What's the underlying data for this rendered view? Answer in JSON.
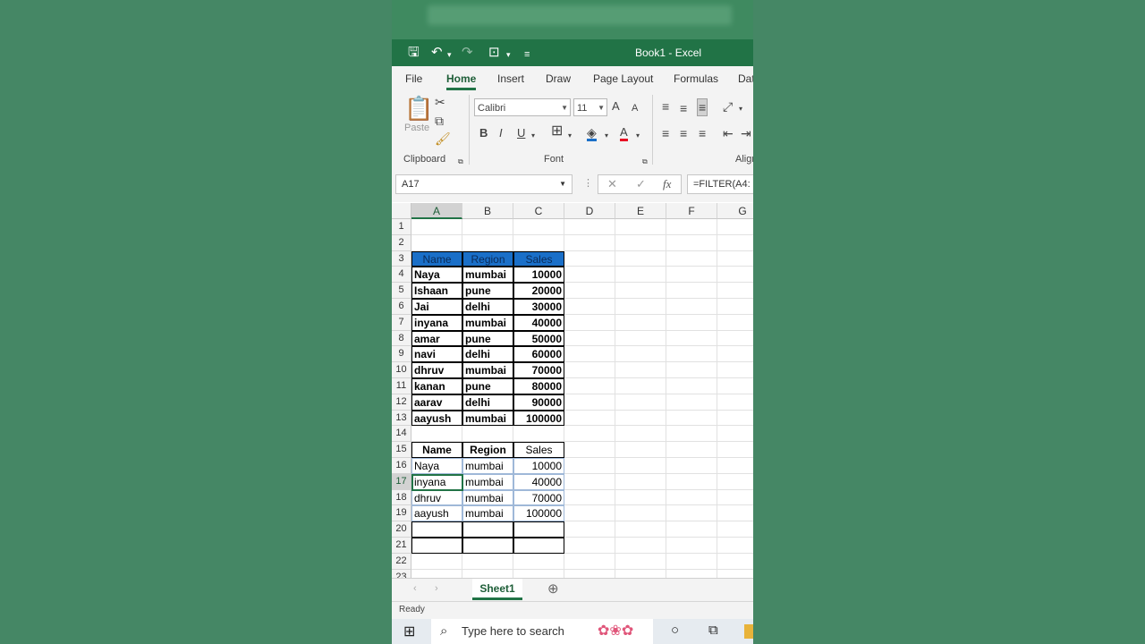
{
  "app": {
    "window_title": "Book1 - Excel"
  },
  "quick_access": {
    "save_icon": "save-icon",
    "undo_icon": "undo-icon",
    "redo_icon": "redo-icon",
    "customize_icon": "customize-icon"
  },
  "ribbon_tabs": [
    "File",
    "Home",
    "Insert",
    "Draw",
    "Page Layout",
    "Formulas",
    "Dat"
  ],
  "ribbon": {
    "paste_label": "Paste",
    "clipboard_label": "Clipboard",
    "font_label": "Font",
    "alignment_label": "Align",
    "font_name": "Calibri",
    "font_size": "11",
    "bold": "B",
    "italic": "I",
    "underline": "U",
    "grow_font": "A",
    "shrink_font": "A",
    "font_color": "A"
  },
  "formula_bar": {
    "name_box": "A17",
    "cancel": "✕",
    "enter": "✓",
    "fx": "fx",
    "formula": "=FILTER(A4:"
  },
  "columns": [
    "A",
    "B",
    "C",
    "D",
    "E",
    "F",
    "G"
  ],
  "rows": [
    "1",
    "2",
    "3",
    "4",
    "5",
    "6",
    "7",
    "8",
    "9",
    "10",
    "11",
    "12",
    "13",
    "14",
    "15",
    "16",
    "17",
    "18",
    "19",
    "20",
    "21",
    "22",
    "23"
  ],
  "source_table": {
    "headers": [
      "Name",
      "Region",
      "Sales"
    ],
    "rows": [
      [
        "Naya",
        "mumbai",
        "10000"
      ],
      [
        "Ishaan",
        "pune",
        "20000"
      ],
      [
        "Jai",
        "delhi",
        "30000"
      ],
      [
        "inyana",
        "mumbai",
        "40000"
      ],
      [
        "amar",
        "pune",
        "50000"
      ],
      [
        "navi",
        "delhi",
        "60000"
      ],
      [
        "dhruv",
        "mumbai",
        "70000"
      ],
      [
        "kanan",
        "pune",
        "80000"
      ],
      [
        "aarav",
        "delhi",
        "90000"
      ],
      [
        "aayush",
        "mumbai",
        "100000"
      ]
    ]
  },
  "filter_table": {
    "headers": [
      "Name",
      "Region",
      "Sales"
    ],
    "rows": [
      [
        "Naya",
        "mumbai",
        "10000"
      ],
      [
        "inyana",
        "mumbai",
        "40000"
      ],
      [
        "dhruv",
        "mumbai",
        "70000"
      ],
      [
        "aayush",
        "mumbai",
        "100000"
      ]
    ]
  },
  "sheet": {
    "tab": "Sheet1"
  },
  "status": {
    "text": "Ready"
  },
  "taskbar": {
    "search_placeholder": "Type here to search"
  },
  "colors": {
    "excel_green": "#217346",
    "header_blue": "#1a6fc8",
    "background": "#458765"
  }
}
